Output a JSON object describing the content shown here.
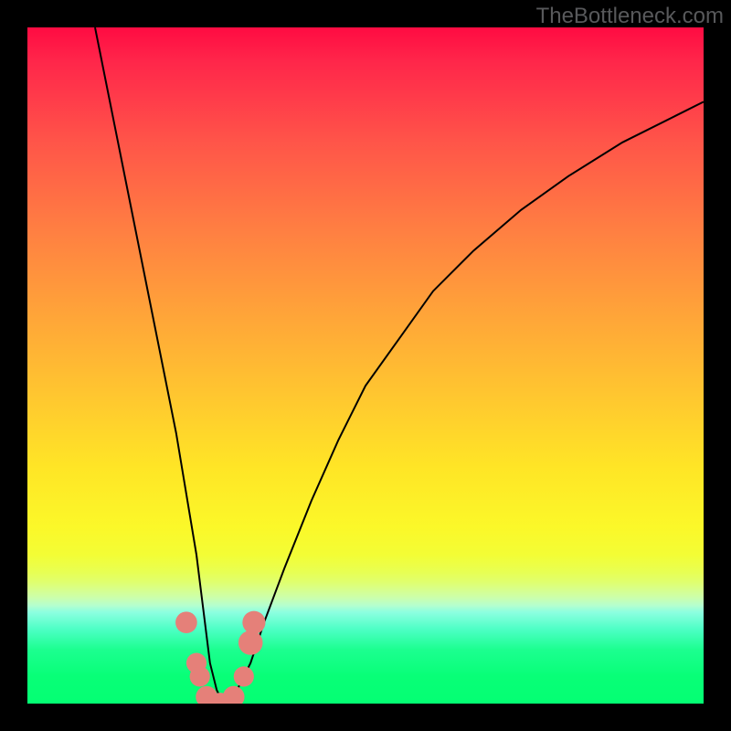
{
  "watermark": "TheBottleneck.com",
  "chart_data": {
    "type": "line",
    "title": "",
    "xlabel": "",
    "ylabel": "",
    "xlim": [
      0,
      100
    ],
    "ylim": [
      0,
      100
    ],
    "background_gradient": {
      "type": "vertical",
      "description": "top red to yellow to green at bottom; represents bottleneck severity",
      "stops": [
        {
          "pos": 0.0,
          "color": "#ff0b42"
        },
        {
          "pos": 0.3,
          "color": "#ff7f42"
        },
        {
          "pos": 0.55,
          "color": "#ffc82f"
        },
        {
          "pos": 0.78,
          "color": "#f3fd35"
        },
        {
          "pos": 0.86,
          "color": "#b4ffcf"
        },
        {
          "pos": 1.0,
          "color": "#04ff73"
        }
      ]
    },
    "series": [
      {
        "name": "bottleneck-curve",
        "color": "#000000",
        "x": [
          10,
          12,
          14,
          16,
          18,
          20,
          22,
          24,
          25,
          26,
          27,
          28,
          29,
          30,
          31,
          33,
          35,
          38,
          42,
          46,
          50,
          55,
          60,
          66,
          73,
          80,
          88,
          96,
          100
        ],
        "y": [
          100,
          90,
          80,
          70,
          60,
          50,
          40,
          28,
          22,
          14,
          6,
          2,
          0,
          0,
          2,
          6,
          12,
          20,
          30,
          39,
          47,
          54,
          61,
          67,
          73,
          78,
          83,
          87,
          89
        ]
      }
    ],
    "markers": [
      {
        "x": 23.5,
        "y": 12,
        "color": "#e58079",
        "r": 1.6
      },
      {
        "x": 25.0,
        "y": 6,
        "color": "#e58079",
        "r": 1.5
      },
      {
        "x": 25.5,
        "y": 4,
        "color": "#e58079",
        "r": 1.5
      },
      {
        "x": 26.5,
        "y": 1,
        "color": "#e58079",
        "r": 1.6
      },
      {
        "x": 28.5,
        "y": 0,
        "color": "#e58079",
        "r": 1.6
      },
      {
        "x": 30.5,
        "y": 1,
        "color": "#e58079",
        "r": 1.6
      },
      {
        "x": 32.0,
        "y": 4,
        "color": "#e58079",
        "r": 1.5
      },
      {
        "x": 33.0,
        "y": 9,
        "color": "#e58079",
        "r": 1.8
      },
      {
        "x": 33.5,
        "y": 12,
        "color": "#e58079",
        "r": 1.7
      }
    ]
  }
}
